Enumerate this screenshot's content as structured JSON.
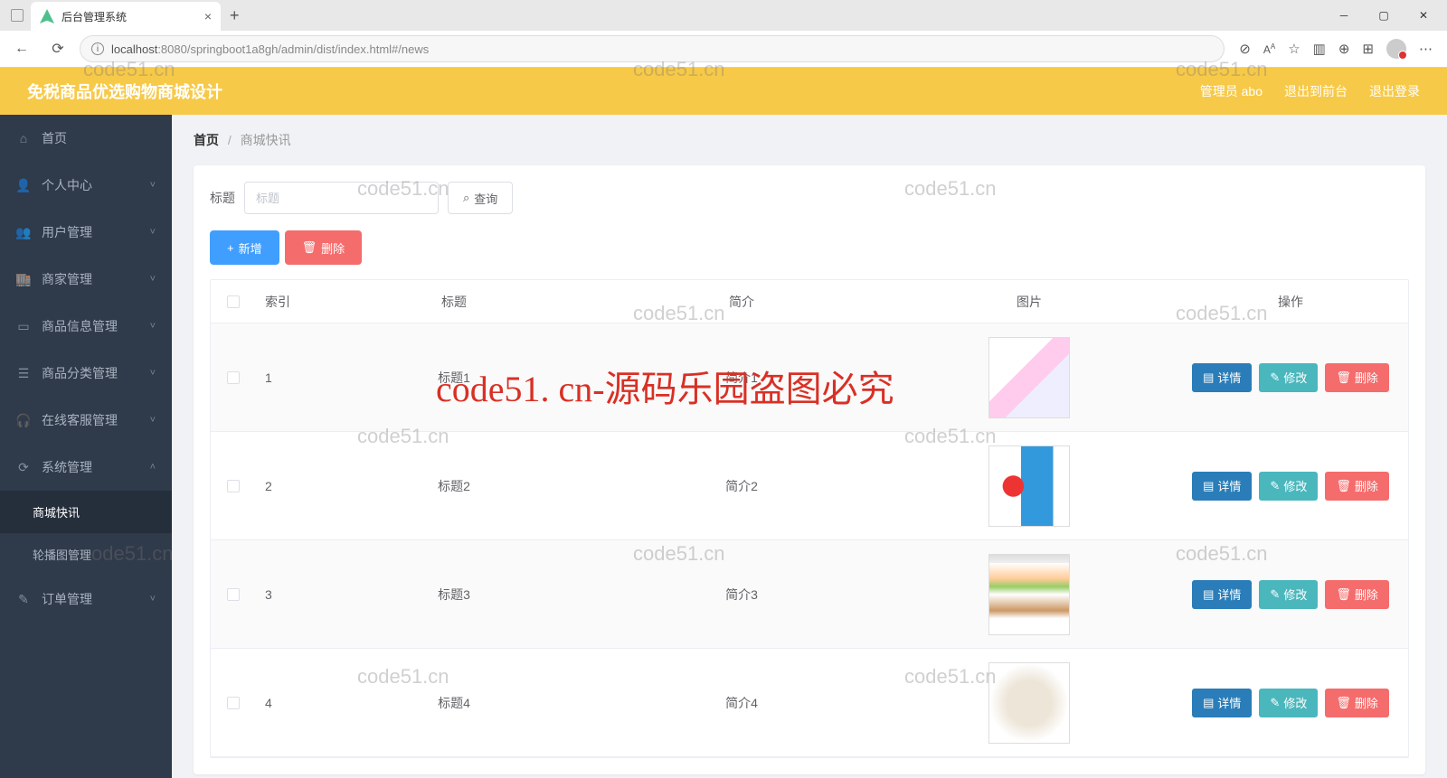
{
  "browser": {
    "tab_title": "后台管理系统",
    "url_host": "localhost",
    "url_port_path": ":8080/springboot1a8gh/admin/dist/index.html#/news"
  },
  "header": {
    "app_title": "免税商品优选购物商城设计",
    "user_label": "管理员 abo",
    "to_front": "退出到前台",
    "logout": "退出登录"
  },
  "sidebar": {
    "items": [
      {
        "icon": "home",
        "label": "首页",
        "expandable": false
      },
      {
        "icon": "user",
        "label": "个人中心",
        "expandable": true
      },
      {
        "icon": "users",
        "label": "用户管理",
        "expandable": true
      },
      {
        "icon": "shop",
        "label": "商家管理",
        "expandable": true
      },
      {
        "icon": "goods",
        "label": "商品信息管理",
        "expandable": true
      },
      {
        "icon": "category",
        "label": "商品分类管理",
        "expandable": true
      },
      {
        "icon": "service",
        "label": "在线客服管理",
        "expandable": true
      },
      {
        "icon": "system",
        "label": "系统管理",
        "expandable": true,
        "expanded": true,
        "children": [
          {
            "label": "商城快讯",
            "active": true
          },
          {
            "label": "轮播图管理",
            "active": false
          }
        ]
      },
      {
        "icon": "order",
        "label": "订单管理",
        "expandable": true
      }
    ]
  },
  "breadcrumb": {
    "home": "首页",
    "current": "商城快讯"
  },
  "search": {
    "label": "标题",
    "placeholder": "标题",
    "query_btn": "查询"
  },
  "actions": {
    "add": "新增",
    "delete": "删除"
  },
  "table": {
    "headers": {
      "index": "索引",
      "title": "标题",
      "intro": "简介",
      "image": "图片",
      "ops": "操作"
    },
    "op_labels": {
      "detail": "详情",
      "edit": "修改",
      "delete": "删除"
    },
    "rows": [
      {
        "idx": "1",
        "title": "标题1",
        "intro": "简介1"
      },
      {
        "idx": "2",
        "title": "标题2",
        "intro": "简介2"
      },
      {
        "idx": "3",
        "title": "标题3",
        "intro": "简介3"
      },
      {
        "idx": "4",
        "title": "标题4",
        "intro": "简介4"
      }
    ]
  },
  "watermark": {
    "small": "code51.cn",
    "big": "code51. cn-源码乐园盗图必究"
  }
}
